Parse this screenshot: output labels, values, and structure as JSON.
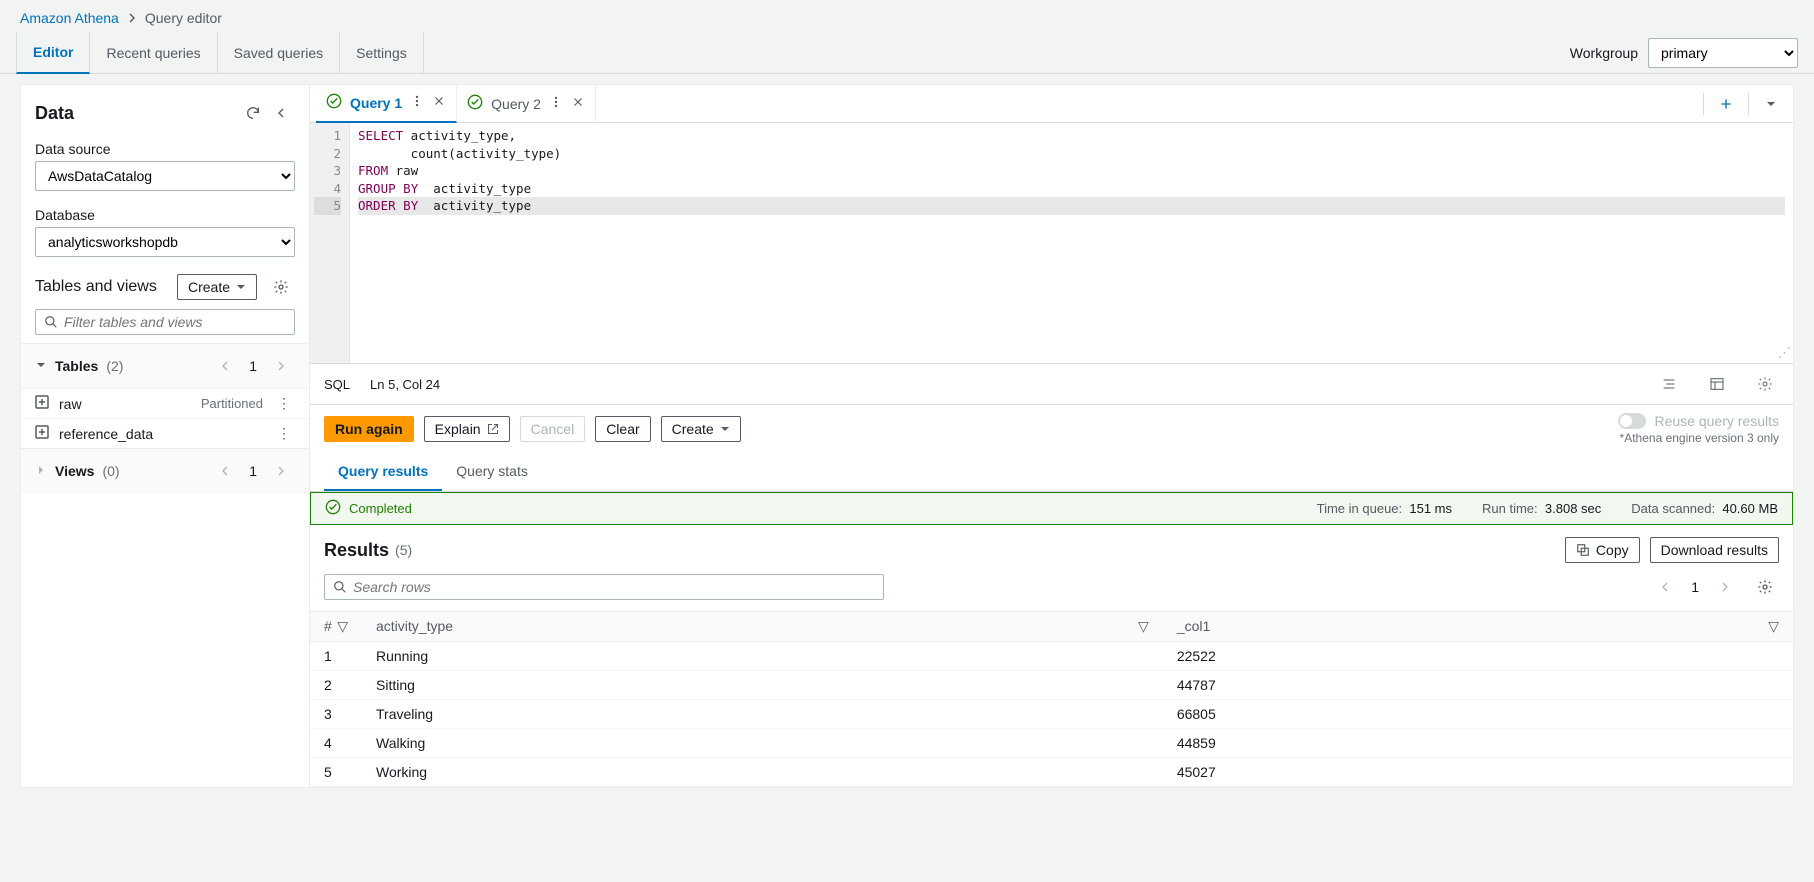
{
  "breadcrumb": {
    "root": "Amazon Athena",
    "current": "Query editor"
  },
  "toptabs": {
    "editor": "Editor",
    "recent": "Recent queries",
    "saved": "Saved queries",
    "settings": "Settings"
  },
  "workgroup": {
    "label": "Workgroup",
    "value": "primary"
  },
  "sidebar": {
    "title": "Data",
    "datasource_label": "Data source",
    "datasource_value": "AwsDataCatalog",
    "database_label": "Database",
    "database_value": "analyticsworkshopdb",
    "tv_title": "Tables and views",
    "create": "Create",
    "filter_placeholder": "Filter tables and views",
    "tables": {
      "label": "Tables",
      "count": "(2)",
      "page": "1"
    },
    "views": {
      "label": "Views",
      "count": "(0)",
      "page": "1"
    },
    "table_items": [
      {
        "name": "raw",
        "badge": "Partitioned"
      },
      {
        "name": "reference_data",
        "badge": ""
      }
    ]
  },
  "qtabs": {
    "q1": "Query 1",
    "q2": "Query 2"
  },
  "editor_lines": {
    "l1a": "SELECT",
    "l1b": " activity_type,",
    "l2": "       count(activity_type)",
    "l3a": "FROM",
    "l3b": " raw",
    "l4a": "GROUP",
    "l4b": " BY",
    "l4c": "  activity_type",
    "l5a": "ORDER",
    "l5b": " BY",
    "l5c": "  activity_type"
  },
  "editor_status": {
    "lang": "SQL",
    "pos": "Ln 5, Col 24"
  },
  "actions": {
    "run": "Run again",
    "explain": "Explain",
    "cancel": "Cancel",
    "clear": "Clear",
    "create": "Create",
    "reuse": "Reuse query results",
    "note": "*Athena engine version 3 only"
  },
  "rtabs": {
    "results": "Query results",
    "stats": "Query stats"
  },
  "completed": {
    "status": "Completed",
    "queue_lbl": "Time in queue:",
    "queue_val": "151 ms",
    "run_lbl": "Run time:",
    "run_val": "3.808 sec",
    "scan_lbl": "Data scanned:",
    "scan_val": "40.60 MB"
  },
  "results": {
    "title": "Results",
    "count": "(5)",
    "copy": "Copy",
    "download": "Download results",
    "search_placeholder": "Search rows",
    "page": "1",
    "columns": {
      "num": "#",
      "c1": "activity_type",
      "c2": "_col1"
    },
    "rows": [
      {
        "n": "1",
        "a": "Running",
        "b": "22522"
      },
      {
        "n": "2",
        "a": "Sitting",
        "b": "44787"
      },
      {
        "n": "3",
        "a": "Traveling",
        "b": "66805"
      },
      {
        "n": "4",
        "a": "Walking",
        "b": "44859"
      },
      {
        "n": "5",
        "a": "Working",
        "b": "45027"
      }
    ]
  }
}
